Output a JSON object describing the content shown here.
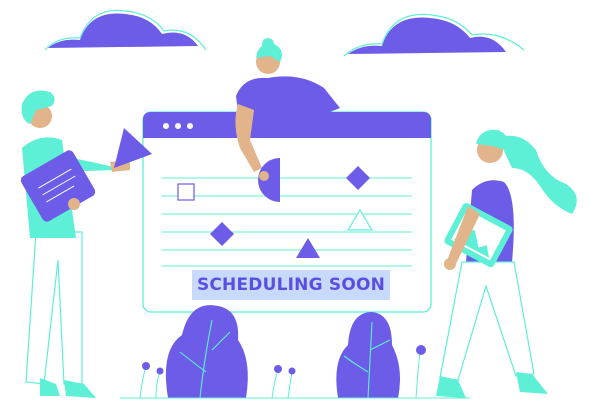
{
  "banner": {
    "text": "SCHEDULING SOON"
  },
  "colors": {
    "purple": "#6c5ce7",
    "teal": "#5ef0d6",
    "skin": "#e2b48c",
    "banner_bg": "#c8dafb",
    "banner_text": "#5a4fe0"
  },
  "icons": {
    "window_dots": "three-dots-icon",
    "checkbox": "square-outline-icon",
    "diamond": "diamond-icon",
    "triangle": "triangle-icon",
    "half_circle": "half-circle-icon",
    "image": "image-icon"
  }
}
